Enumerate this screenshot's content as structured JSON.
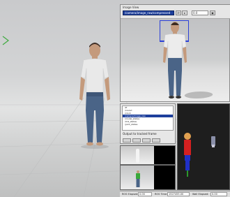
{
  "camera_panel": {
    "title": "Image View",
    "selected_topic": "/camera/image_raw/compressed",
    "field_value": "0.0",
    "buttons": [
      "⟳",
      "▸",
      "▣"
    ]
  },
  "topic_list": {
    "rows": [
      "/tf",
      "/rosout",
      "/clock",
      "/camera/image_raw",
      "/model_states",
      "/link_states",
      "/joint_states"
    ],
    "selected_index": 3,
    "label": "Output to tracked frame"
  },
  "status_bar": {
    "items": [
      {
        "label": "ROS Elapsed:",
        "value": "0.00"
      },
      {
        "label": "ROS Time:",
        "value": "1527455.00"
      },
      {
        "label": "Wall Elapsed:",
        "value": "0.00"
      }
    ]
  },
  "colors": {
    "selection": "#1d3f9c",
    "viewport_floor": "#e2e3e3",
    "dark_view": "#1e1e1e"
  }
}
